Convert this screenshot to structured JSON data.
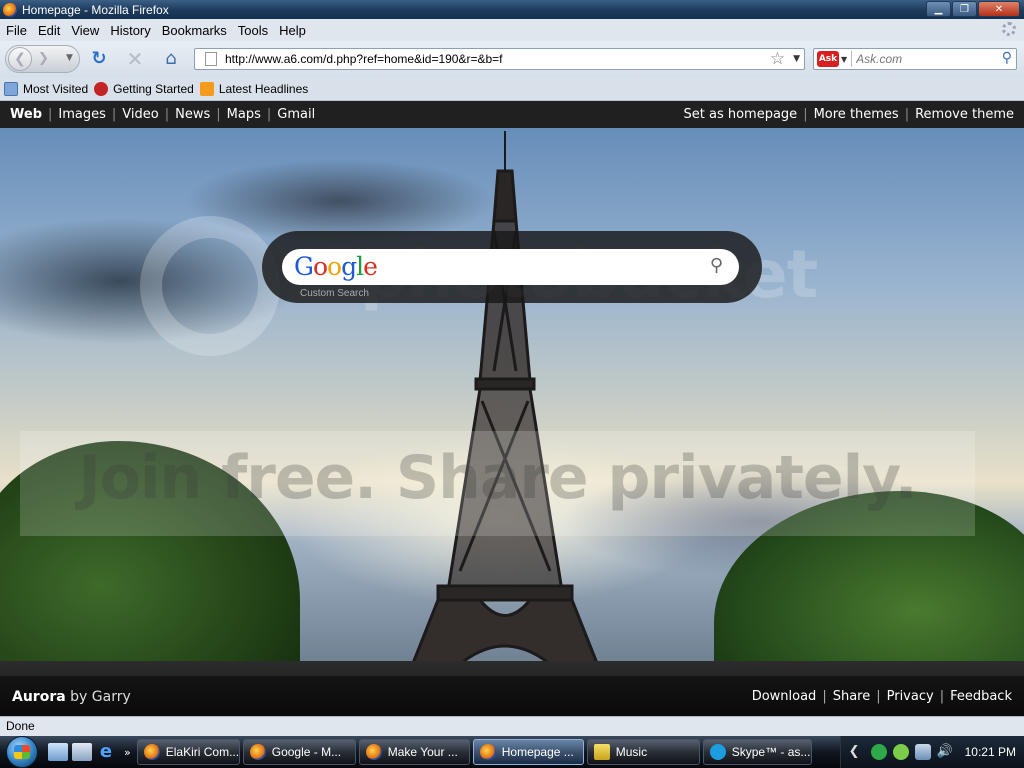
{
  "window": {
    "title": "Homepage - Mozilla Firefox",
    "controls": [
      "minimize",
      "maximize",
      "close"
    ]
  },
  "menubar": {
    "items": [
      "File",
      "Edit",
      "View",
      "History",
      "Bookmarks",
      "Tools",
      "Help"
    ]
  },
  "navbar": {
    "url": "http://www.a6.com/d.php?ref=home&id=190&r=&b=f",
    "search_placeholder": "Ask.com",
    "search_engine_logo": "Ask"
  },
  "bookmarks": {
    "items": [
      "Most Visited",
      "Getting Started",
      "Latest Headlines"
    ]
  },
  "page": {
    "topnav_left": [
      "Web",
      "Images",
      "Video",
      "News",
      "Maps",
      "Gmail"
    ],
    "topnav_right": [
      "Set as homepage",
      "More themes",
      "Remove theme"
    ],
    "google_logo": [
      "G",
      "o",
      "o",
      "g",
      "l",
      "e"
    ],
    "custom_search": "Custom Search",
    "watermark_top": "photobucket",
    "watermark_band": "Join free. Share privately.",
    "theme_name": "Aurora",
    "theme_by": "by Garry",
    "bottom_links": [
      "Download",
      "Share",
      "Privacy",
      "Feedback"
    ]
  },
  "statusbar": {
    "text": "Done"
  },
  "taskbar": {
    "tasks": [
      "ElaKiri Com...",
      "Google - M...",
      "Make Your ...",
      "Homepage ...",
      "Music",
      "Skype™ - as..."
    ],
    "clock": "10:21 PM"
  },
  "colors": {
    "titlebar": "#1d3a5c",
    "page_nav": "#202020",
    "url_bar_border": "#8da0b6",
    "ask_red": "#d81e1e"
  }
}
